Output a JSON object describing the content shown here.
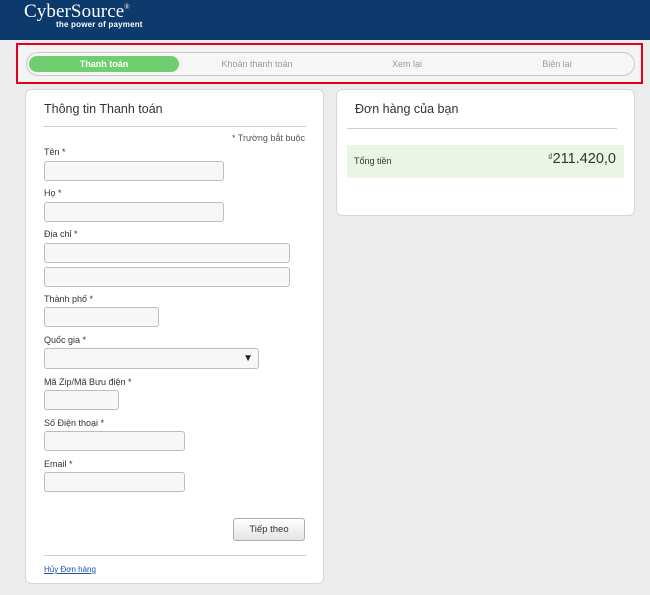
{
  "header": {
    "logo_text": "CyberSource",
    "logo_mark": "®",
    "tagline": "the power of payment"
  },
  "steps": [
    {
      "label": "Thanh toán",
      "active": true
    },
    {
      "label": "Khoản thanh toán",
      "active": false
    },
    {
      "label": "Xem lại",
      "active": false
    },
    {
      "label": "Biên lai",
      "active": false
    }
  ],
  "payment_form": {
    "title": "Thông tin Thanh toán",
    "required_note": "* Trường bắt buộc",
    "fields": {
      "first_name": {
        "label": "Tên *",
        "value": ""
      },
      "last_name": {
        "label": "Họ *",
        "value": ""
      },
      "address": {
        "label": "Địa chỉ *",
        "line1": "",
        "line2": ""
      },
      "city": {
        "label": "Thành phố *",
        "value": ""
      },
      "country": {
        "label": "Quốc gia *",
        "selected": ""
      },
      "zip": {
        "label": "Mã Zip/Mã Bưu điện *",
        "value": ""
      },
      "phone": {
        "label": "Số Điện thoại *",
        "value": ""
      },
      "email": {
        "label": "Email *",
        "value": ""
      }
    },
    "next_button": "Tiếp theo",
    "cancel_link": "Hủy Đơn hàng"
  },
  "order_summary": {
    "title": "Đơn hàng của bạn",
    "total_label": "Tổng tiền",
    "currency_symbol": "₫",
    "total_value": "211.420,0"
  },
  "colors": {
    "header_bg": "#0d3a6c",
    "active_step": "#6fcf6e",
    "highlight_border": "#e1001e",
    "total_row_bg": "#eaf5e6",
    "link": "#1f4fb5"
  }
}
